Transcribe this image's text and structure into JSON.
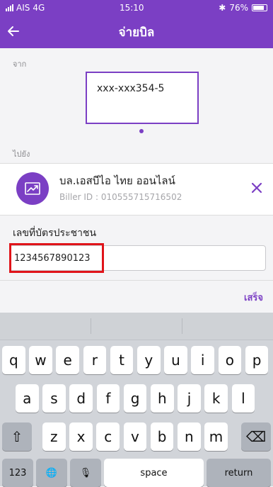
{
  "status": {
    "carrier": "AIS",
    "network": "4G",
    "time": "15:10",
    "bluetooth": "✱",
    "battery": "76%"
  },
  "nav": {
    "back_icon": "arrow-left-icon",
    "title": "จ่ายบิล"
  },
  "from": {
    "label": "จาก",
    "account": "xxx-xxx354-5"
  },
  "to": {
    "label": "ไปยัง"
  },
  "biller": {
    "name": "บล.เอสบีไอ ไทย ออนไลน์",
    "id_text": "Biller ID : 010555715716502",
    "remove_icon": "close-icon"
  },
  "id_field": {
    "label": "เลขที่บัตรประชาชน",
    "value": "1234567890123"
  },
  "done_label": "เสร็จ",
  "keyboard": {
    "row1": [
      "q",
      "w",
      "e",
      "r",
      "t",
      "y",
      "u",
      "i",
      "o",
      "p"
    ],
    "row2": [
      "a",
      "s",
      "d",
      "f",
      "g",
      "h",
      "j",
      "k",
      "l"
    ],
    "row3": [
      "z",
      "x",
      "c",
      "v",
      "b",
      "n",
      "m"
    ],
    "shift": "⇧",
    "delete": "⌫",
    "numbers": "123",
    "globe": "🌐",
    "mic": "🎙",
    "space": "space",
    "return": "return"
  },
  "colors": {
    "accent": "#7b3fc4",
    "highlight": "#e0141a"
  }
}
